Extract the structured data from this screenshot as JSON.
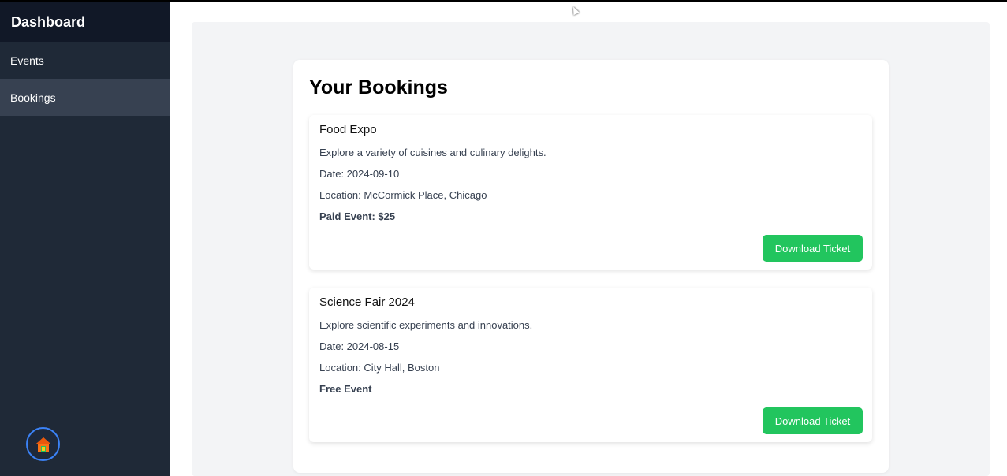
{
  "sidebar": {
    "title": "Dashboard",
    "items": [
      {
        "label": "Events"
      },
      {
        "label": "Bookings"
      }
    ],
    "home_icon": "house-icon"
  },
  "main": {
    "title": "Your Bookings",
    "bookings": [
      {
        "title": "Food Expo",
        "description": "Explore a variety of cuisines and culinary delights.",
        "date": "Date: 2024-09-10",
        "location": "Location: McCormick Place, Chicago",
        "price": "Paid Event: $25",
        "button": "Download Ticket"
      },
      {
        "title": "Science Fair 2024",
        "description": "Explore scientific experiments and innovations.",
        "date": "Date: 2024-08-15",
        "location": "Location: City Hall, Boston",
        "price": "Free Event",
        "button": "Download Ticket"
      }
    ]
  },
  "colors": {
    "sidebar_bg": "#1f2937",
    "sidebar_header_bg": "#111827",
    "active_nav_bg": "#374151",
    "button_green": "#22c55e",
    "paid_red": "#b91c1c",
    "free_green": "#16a34a"
  }
}
